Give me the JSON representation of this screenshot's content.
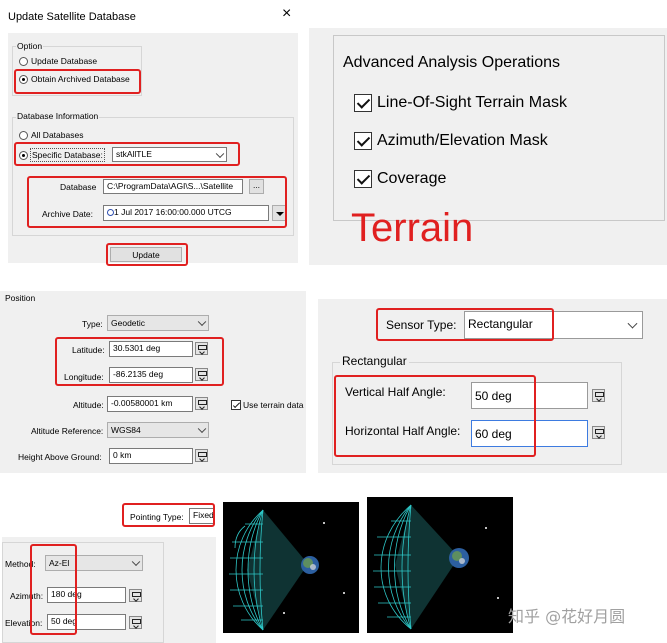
{
  "update_db": {
    "title": "Update Satellite Database",
    "close_glyph": "×",
    "option_group": "Option",
    "option_update": "Update Database",
    "option_obtain": "Obtain Archived Database",
    "dbinfo_group": "Database Information",
    "all_databases": "All Databases",
    "specific_database": "Specific Database:",
    "specific_value": "stkAllTLE",
    "database_label": "Database",
    "database_value": "C:\\ProgramData\\AGI\\S...\\Satellite",
    "browse_label": "...",
    "archive_label": "Archive Date:",
    "archive_value": "1 Jul 2017 16:00:00.000 UTCG",
    "update_button": "Update"
  },
  "advanced": {
    "title": "Advanced Analysis Operations",
    "items": [
      "Line-Of-Sight Terrain Mask",
      "Azimuth/Elevation Mask",
      "Coverage"
    ],
    "overlay": "Terrain"
  },
  "position": {
    "group": "Position",
    "type_label": "Type:",
    "type_value": "Geodetic",
    "latitude_label": "Latitude:",
    "latitude_value": "30.5301 deg",
    "longitude_label": "Longitude:",
    "longitude_value": "-86.2135 deg",
    "altitude_label": "Altitude:",
    "altitude_value": "-0.00580001 km",
    "use_terrain": "Use terrain data",
    "altref_label": "Altitude Reference:",
    "altref_value": "WGS84",
    "hag_label": "Height Above Ground:",
    "hag_value": "0 km"
  },
  "sensor": {
    "type_label": "Sensor Type:",
    "type_value": "Rectangular",
    "group": "Rectangular",
    "vertical_label": "Vertical Half Angle:",
    "vertical_value": "50 deg",
    "horizontal_label": "Horizontal Half Angle:",
    "horizontal_value": "60 deg"
  },
  "pointing": {
    "type_label": "Pointing Type:",
    "type_value": "Fixed",
    "method_label": "Method:",
    "method_value": "Az-El",
    "azimuth_label": "Azimuth:",
    "azimuth_value": "180 deg",
    "elevation_label": "Elevation:",
    "elevation_value": "50 deg"
  },
  "watermark": "知乎 @花好月圆",
  "colors": {
    "highlight": "#e02020",
    "mesh": "#2ec8c8",
    "space": "#000000"
  }
}
